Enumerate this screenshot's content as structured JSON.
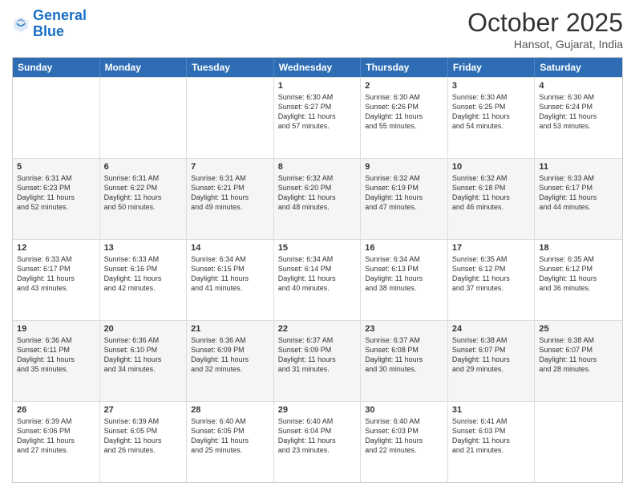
{
  "header": {
    "logo_line1": "General",
    "logo_line2": "Blue",
    "month": "October 2025",
    "location": "Hansot, Gujarat, India"
  },
  "days_of_week": [
    "Sunday",
    "Monday",
    "Tuesday",
    "Wednesday",
    "Thursday",
    "Friday",
    "Saturday"
  ],
  "weeks": [
    [
      {
        "day": "",
        "info": ""
      },
      {
        "day": "",
        "info": ""
      },
      {
        "day": "",
        "info": ""
      },
      {
        "day": "1",
        "info": "Sunrise: 6:30 AM\nSunset: 6:27 PM\nDaylight: 11 hours\nand 57 minutes."
      },
      {
        "day": "2",
        "info": "Sunrise: 6:30 AM\nSunset: 6:26 PM\nDaylight: 11 hours\nand 55 minutes."
      },
      {
        "day": "3",
        "info": "Sunrise: 6:30 AM\nSunset: 6:25 PM\nDaylight: 11 hours\nand 54 minutes."
      },
      {
        "day": "4",
        "info": "Sunrise: 6:30 AM\nSunset: 6:24 PM\nDaylight: 11 hours\nand 53 minutes."
      }
    ],
    [
      {
        "day": "5",
        "info": "Sunrise: 6:31 AM\nSunset: 6:23 PM\nDaylight: 11 hours\nand 52 minutes."
      },
      {
        "day": "6",
        "info": "Sunrise: 6:31 AM\nSunset: 6:22 PM\nDaylight: 11 hours\nand 50 minutes."
      },
      {
        "day": "7",
        "info": "Sunrise: 6:31 AM\nSunset: 6:21 PM\nDaylight: 11 hours\nand 49 minutes."
      },
      {
        "day": "8",
        "info": "Sunrise: 6:32 AM\nSunset: 6:20 PM\nDaylight: 11 hours\nand 48 minutes."
      },
      {
        "day": "9",
        "info": "Sunrise: 6:32 AM\nSunset: 6:19 PM\nDaylight: 11 hours\nand 47 minutes."
      },
      {
        "day": "10",
        "info": "Sunrise: 6:32 AM\nSunset: 6:18 PM\nDaylight: 11 hours\nand 46 minutes."
      },
      {
        "day": "11",
        "info": "Sunrise: 6:33 AM\nSunset: 6:17 PM\nDaylight: 11 hours\nand 44 minutes."
      }
    ],
    [
      {
        "day": "12",
        "info": "Sunrise: 6:33 AM\nSunset: 6:17 PM\nDaylight: 11 hours\nand 43 minutes."
      },
      {
        "day": "13",
        "info": "Sunrise: 6:33 AM\nSunset: 6:16 PM\nDaylight: 11 hours\nand 42 minutes."
      },
      {
        "day": "14",
        "info": "Sunrise: 6:34 AM\nSunset: 6:15 PM\nDaylight: 11 hours\nand 41 minutes."
      },
      {
        "day": "15",
        "info": "Sunrise: 6:34 AM\nSunset: 6:14 PM\nDaylight: 11 hours\nand 40 minutes."
      },
      {
        "day": "16",
        "info": "Sunrise: 6:34 AM\nSunset: 6:13 PM\nDaylight: 11 hours\nand 38 minutes."
      },
      {
        "day": "17",
        "info": "Sunrise: 6:35 AM\nSunset: 6:12 PM\nDaylight: 11 hours\nand 37 minutes."
      },
      {
        "day": "18",
        "info": "Sunrise: 6:35 AM\nSunset: 6:12 PM\nDaylight: 11 hours\nand 36 minutes."
      }
    ],
    [
      {
        "day": "19",
        "info": "Sunrise: 6:36 AM\nSunset: 6:11 PM\nDaylight: 11 hours\nand 35 minutes."
      },
      {
        "day": "20",
        "info": "Sunrise: 6:36 AM\nSunset: 6:10 PM\nDaylight: 11 hours\nand 34 minutes."
      },
      {
        "day": "21",
        "info": "Sunrise: 6:36 AM\nSunset: 6:09 PM\nDaylight: 11 hours\nand 32 minutes."
      },
      {
        "day": "22",
        "info": "Sunrise: 6:37 AM\nSunset: 6:09 PM\nDaylight: 11 hours\nand 31 minutes."
      },
      {
        "day": "23",
        "info": "Sunrise: 6:37 AM\nSunset: 6:08 PM\nDaylight: 11 hours\nand 30 minutes."
      },
      {
        "day": "24",
        "info": "Sunrise: 6:38 AM\nSunset: 6:07 PM\nDaylight: 11 hours\nand 29 minutes."
      },
      {
        "day": "25",
        "info": "Sunrise: 6:38 AM\nSunset: 6:07 PM\nDaylight: 11 hours\nand 28 minutes."
      }
    ],
    [
      {
        "day": "26",
        "info": "Sunrise: 6:39 AM\nSunset: 6:06 PM\nDaylight: 11 hours\nand 27 minutes."
      },
      {
        "day": "27",
        "info": "Sunrise: 6:39 AM\nSunset: 6:05 PM\nDaylight: 11 hours\nand 26 minutes."
      },
      {
        "day": "28",
        "info": "Sunrise: 6:40 AM\nSunset: 6:05 PM\nDaylight: 11 hours\nand 25 minutes."
      },
      {
        "day": "29",
        "info": "Sunrise: 6:40 AM\nSunset: 6:04 PM\nDaylight: 11 hours\nand 23 minutes."
      },
      {
        "day": "30",
        "info": "Sunrise: 6:40 AM\nSunset: 6:03 PM\nDaylight: 11 hours\nand 22 minutes."
      },
      {
        "day": "31",
        "info": "Sunrise: 6:41 AM\nSunset: 6:03 PM\nDaylight: 11 hours\nand 21 minutes."
      },
      {
        "day": "",
        "info": ""
      }
    ]
  ]
}
